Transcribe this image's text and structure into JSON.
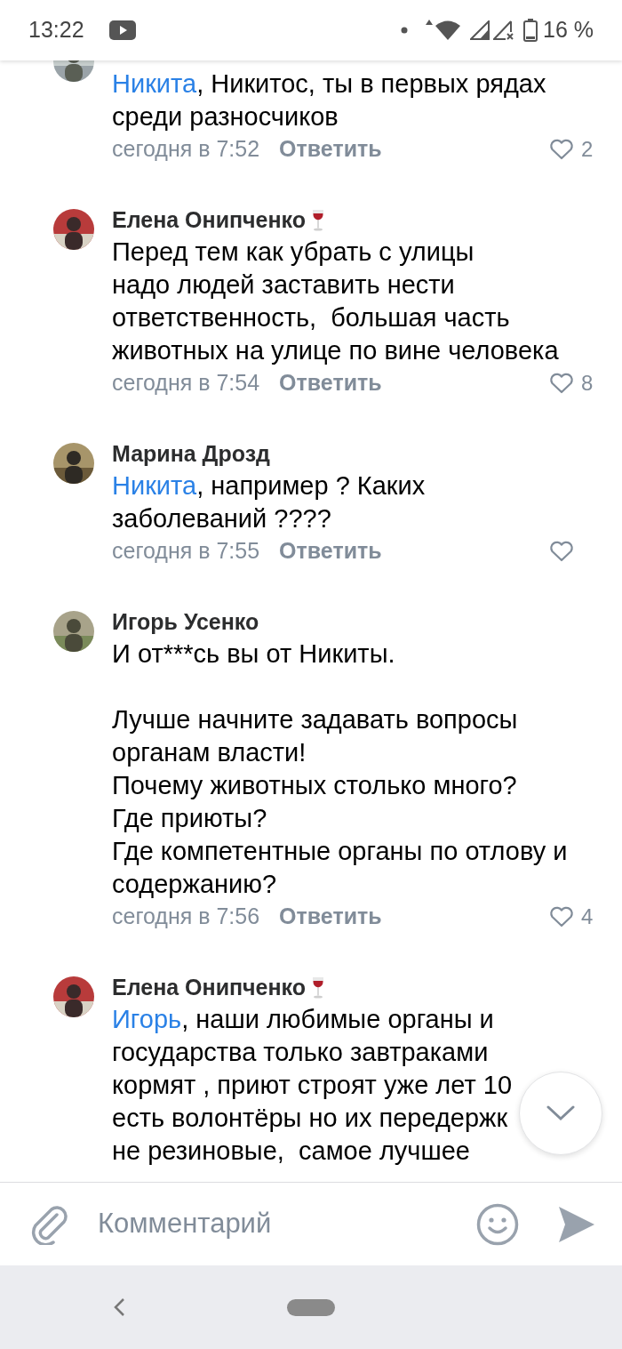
{
  "status_bar": {
    "time": "13:22",
    "battery": "16 %"
  },
  "comments": [
    {
      "mention": "Никита",
      "text": ", Никитос, ты в первых рядах\nсреди разносчиков",
      "time": "сегодня в 7:52",
      "reply": "Ответить",
      "likes": "2"
    },
    {
      "author": "Елена Онипченко",
      "wine": true,
      "text": "Перед тем как убрать с улицы\nнадо людей заставить нести\nответственность,  большая часть\nживотных на улице по вине человека",
      "time": "сегодня в 7:54",
      "reply": "Ответить",
      "likes": "8"
    },
    {
      "author": "Марина Дрозд",
      "wine": false,
      "mention": "Никита",
      "text": ", например ? Каких\nзаболеваний ????",
      "time": "сегодня в 7:55",
      "reply": "Ответить"
    },
    {
      "author": "Игорь Усенко",
      "wine": false,
      "text": "И от***сь вы от Никиты.\n\nЛучше начните задавать вопросы\nорганам власти!\nПочему животных столько много?\nГде приюты?\nГде компетентные органы по отлову и\nсодержанию?",
      "time": "сегодня в 7:56",
      "reply": "Ответить",
      "likes": "4"
    },
    {
      "author": "Елена Онипченко",
      "wine": true,
      "mention": "Игорь",
      "text": ", наши любимые органы и\nгосударства только завтраками\nкормят , приют строят уже лет 10\nесть волонтёры но их передержк\nне резиновые,  самое лучшее"
    }
  ],
  "composer": {
    "placeholder": "Комментарий"
  }
}
